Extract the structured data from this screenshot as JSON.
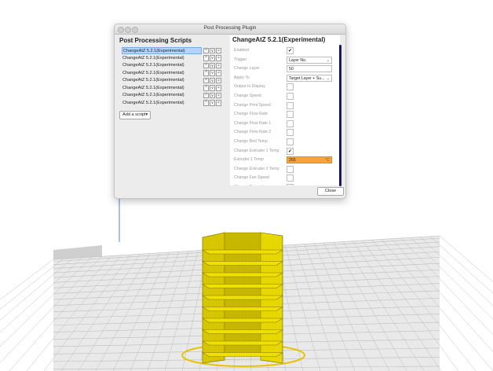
{
  "window": {
    "title": "Post Processing Plugin"
  },
  "left_panel": {
    "heading": "Post Processing Scripts",
    "scripts": [
      {
        "name": "ChangeAtZ 5.2.1(Experimental)",
        "selected": true
      },
      {
        "name": "ChangeAtZ 5.2.1(Experimental)",
        "selected": false
      },
      {
        "name": "ChangeAtZ 5.2.1(Experimental)",
        "selected": false
      },
      {
        "name": "ChangeAtZ 5.2.1(Experimental)",
        "selected": false
      },
      {
        "name": "ChangeAtZ 5.2.1(Experimental)",
        "selected": false
      },
      {
        "name": "ChangeAtZ 5.2.1(Experimental)",
        "selected": false
      },
      {
        "name": "ChangeAtZ 5.2.1(Experimental)",
        "selected": false
      },
      {
        "name": "ChangeAtZ 5.2.1(Experimental)",
        "selected": false
      }
    ],
    "row_buttons": {
      "up": "^",
      "down": "v",
      "remove": "×"
    },
    "add_script_label": "Add a script▾"
  },
  "right_panel": {
    "heading": "ChangeAtZ 5.2.1(Experimental)",
    "settings": [
      {
        "label": "Enabled",
        "type": "check",
        "checked": true
      },
      {
        "label": "Trigger",
        "type": "select",
        "value": "Layer No."
      },
      {
        "label": "Change Layer",
        "type": "text",
        "value": "50"
      },
      {
        "label": "Apply To",
        "type": "select",
        "value": "Target Layer + Su..."
      },
      {
        "label": "Output to Display",
        "type": "check",
        "checked": false
      },
      {
        "label": "Change Speed",
        "type": "check",
        "checked": false
      },
      {
        "label": "Change Print Speed",
        "type": "check",
        "checked": false
      },
      {
        "label": "Change Flow Rate",
        "type": "check",
        "checked": false
      },
      {
        "label": "Change Flow Rate 1",
        "type": "check",
        "checked": false
      },
      {
        "label": "Change Flow Rate 2",
        "type": "check",
        "checked": false
      },
      {
        "label": "Change Bed Temp",
        "type": "check",
        "checked": false
      },
      {
        "label": "Change Extruder 1 Temp",
        "type": "check",
        "checked": true
      },
      {
        "label": "Extruder 1 Temp",
        "type": "text",
        "value": "255",
        "unit": "°C",
        "highlight": true
      },
      {
        "label": "Change Extruder 2 Temp",
        "type": "check",
        "checked": false
      },
      {
        "label": "Change Fan Speed",
        "type": "check",
        "checked": false
      },
      {
        "label": "Change Retraction",
        "type": "check",
        "checked": false
      }
    ]
  },
  "close_label": "Close",
  "colors": {
    "selection": "#b7d5fb",
    "highlight_field": "#f7a43c",
    "model_yellow": "#f5e400",
    "build_plate": "#e9e9e9",
    "grid_line": "#bdbdbd"
  }
}
